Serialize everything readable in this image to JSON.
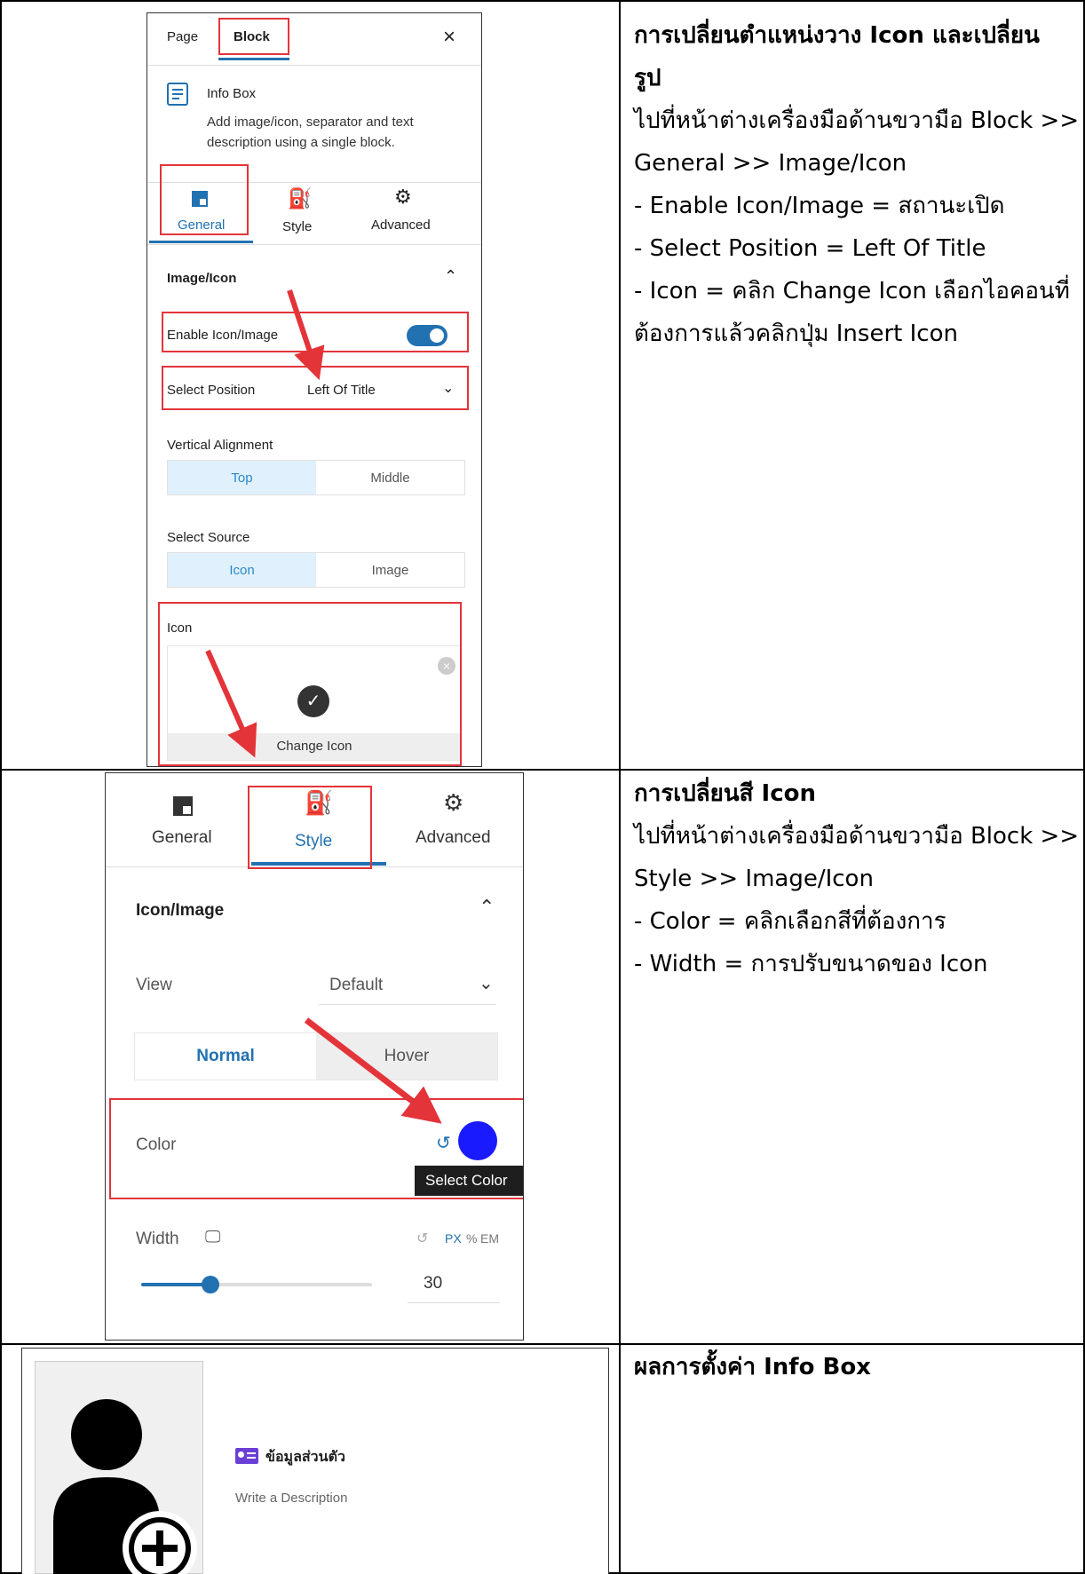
{
  "rows": [
    {
      "title_lines": [
        "การเปลี่ยนตำแหน่งวาง Icon และเปลี่ยน",
        "รูป"
      ],
      "body_lines": [
        "ไปที่หน้าต่างเครื่องมือด้านขวามือ Block >>",
        "General >> Image/Icon",
        "- Enable Icon/Image = สถานะเปิด",
        "- Select Position = Left Of Title",
        "- Icon = คลิก Change Icon เลือกไอคอนที่",
        "ต้องการแล้วคลิกปุ่ม Insert Icon"
      ]
    },
    {
      "title_lines": [
        "การเปลี่ยนสี Icon"
      ],
      "body_lines": [
        "ไปที่หน้าต่างเครื่องมือด้านขวามือ Block >>",
        "Style >> Image/Icon",
        "- Color = คลิกเลือกสีที่ต้องการ",
        "- Width = การปรับขนาดของ Icon"
      ]
    },
    {
      "title_lines": [
        "ผลการตั้งค่า Info Box"
      ],
      "body_lines": []
    }
  ],
  "panel1": {
    "tabs": [
      "Page",
      "Block"
    ],
    "close": "×",
    "block_name": "Info Box",
    "block_desc": [
      "Add image/icon, separator and text",
      "description using a single block."
    ],
    "inner_tabs": [
      "General",
      "Style",
      "Advanced"
    ],
    "section": "Image/Icon",
    "enable_label": "Enable Icon/Image",
    "position_label": "Select Position",
    "position_value": "Left Of Title",
    "valign_label": "Vertical Alignment",
    "valign_options": [
      "Top",
      "Middle"
    ],
    "source_label": "Select Source",
    "source_options": [
      "Icon",
      "Image"
    ],
    "icon_label": "Icon",
    "change_icon": "Change Icon",
    "accent": "#2271b1"
  },
  "panel2": {
    "inner_tabs": [
      "General",
      "Style",
      "Advanced"
    ],
    "section": "Icon/Image",
    "view_label": "View",
    "view_value": "Default",
    "states": [
      "Normal",
      "Hover"
    ],
    "color_label": "Color",
    "tooltip": "Select Color",
    "swatch": "#1a1aff",
    "width_label": "Width",
    "units": [
      "PX",
      "%",
      "EM"
    ],
    "width_value": "30",
    "slider_fraction": 0.3
  },
  "panel3": {
    "heading": "ข้อมูลส่วนตัว",
    "description": "Write a Description",
    "accent": "#6b3fd6"
  }
}
